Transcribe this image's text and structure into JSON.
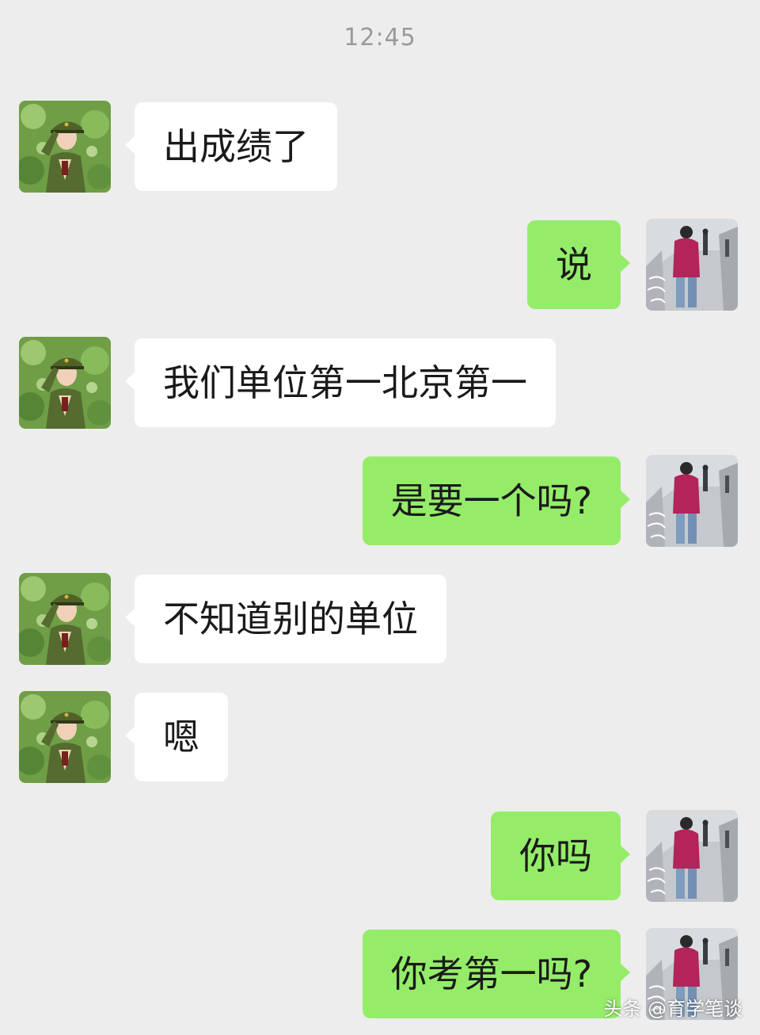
{
  "chat": {
    "timestamp": "12:45",
    "messages": [
      {
        "side": "left",
        "text": "出成绩了"
      },
      {
        "side": "right",
        "text": "说"
      },
      {
        "side": "left",
        "text": "我们单位第一北京第一"
      },
      {
        "side": "right",
        "text": "是要一个吗?"
      },
      {
        "side": "left",
        "text": "不知道别的单位"
      },
      {
        "side": "left",
        "text": "嗯"
      },
      {
        "side": "right",
        "text": "你吗"
      },
      {
        "side": "right",
        "text": "你考第一吗?"
      }
    ]
  },
  "watermark": "头条 @育学笔谈",
  "colors": {
    "background": "#ededed",
    "sent_bubble": "#95ec69",
    "received_bubble": "#ffffff",
    "timestamp_text": "#9a9a9a"
  },
  "icons": {
    "contact_avatar": "contact-avatar-icon",
    "self_avatar": "self-avatar-icon"
  }
}
